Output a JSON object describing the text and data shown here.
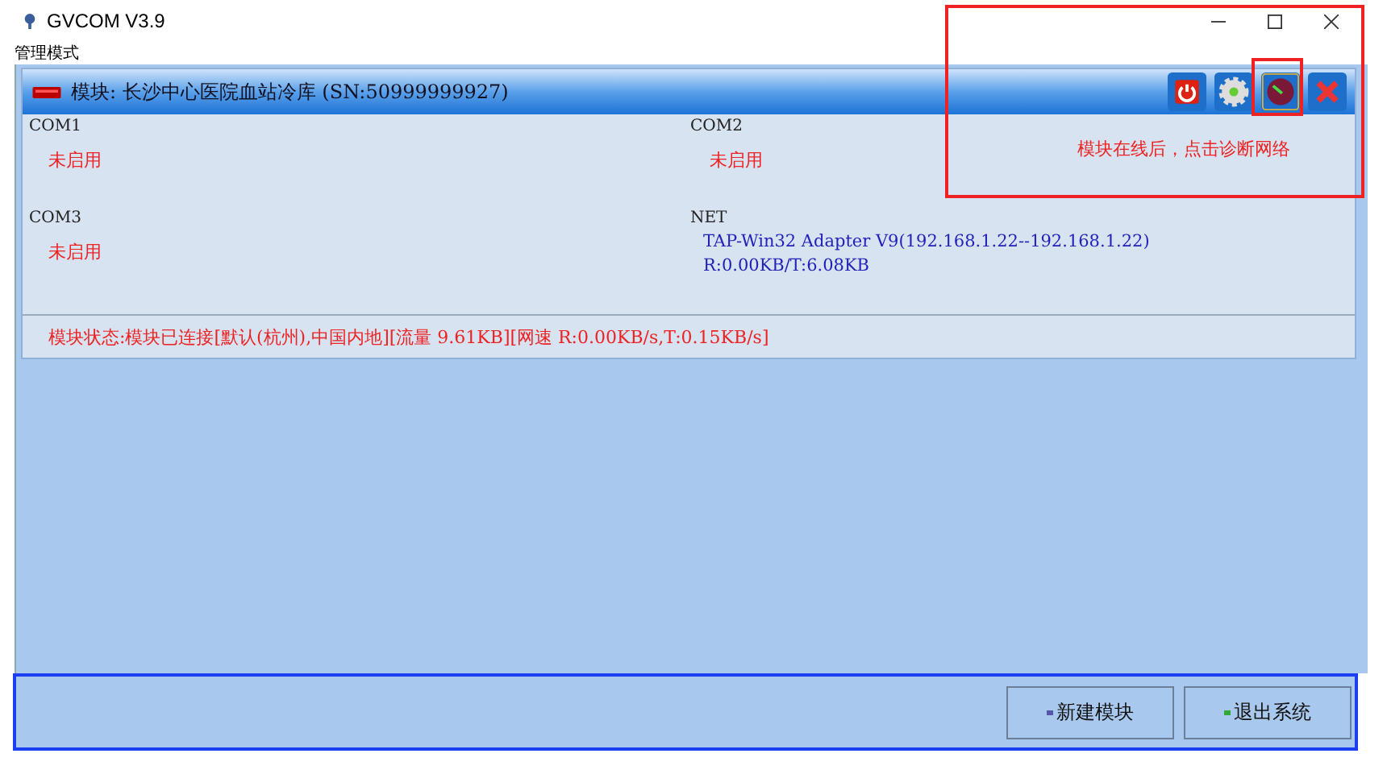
{
  "window": {
    "title": "GVCOM  V3.9"
  },
  "menu": {
    "label": "管理模式"
  },
  "module": {
    "title": "模块: 长沙中心医院血站冷库 (SN:50999999927)",
    "ports": [
      {
        "name": "COM1",
        "lines": [
          "未启用"
        ],
        "kind": "off"
      },
      {
        "name": "COM2",
        "lines": [
          "未启用"
        ],
        "kind": "off"
      },
      {
        "name": "COM3",
        "lines": [
          "未启用"
        ],
        "kind": "off"
      },
      {
        "name": "NET",
        "lines": [
          "TAP-Win32 Adapter V9(192.168.1.22--192.168.1.22)",
          "R:0.00KB/T:6.08KB"
        ],
        "kind": "on"
      }
    ],
    "status": "模块状态:模块已连接[默认(杭州),中国内地][流量 9.61KB][网速 R:0.00KB/s,T:0.15KB/s]"
  },
  "annotation": {
    "text": "模块在线后，点击诊断网络"
  },
  "buttons": [
    {
      "label": "新建模块",
      "kind": "new"
    },
    {
      "label": "退出系统",
      "kind": "exit"
    }
  ]
}
